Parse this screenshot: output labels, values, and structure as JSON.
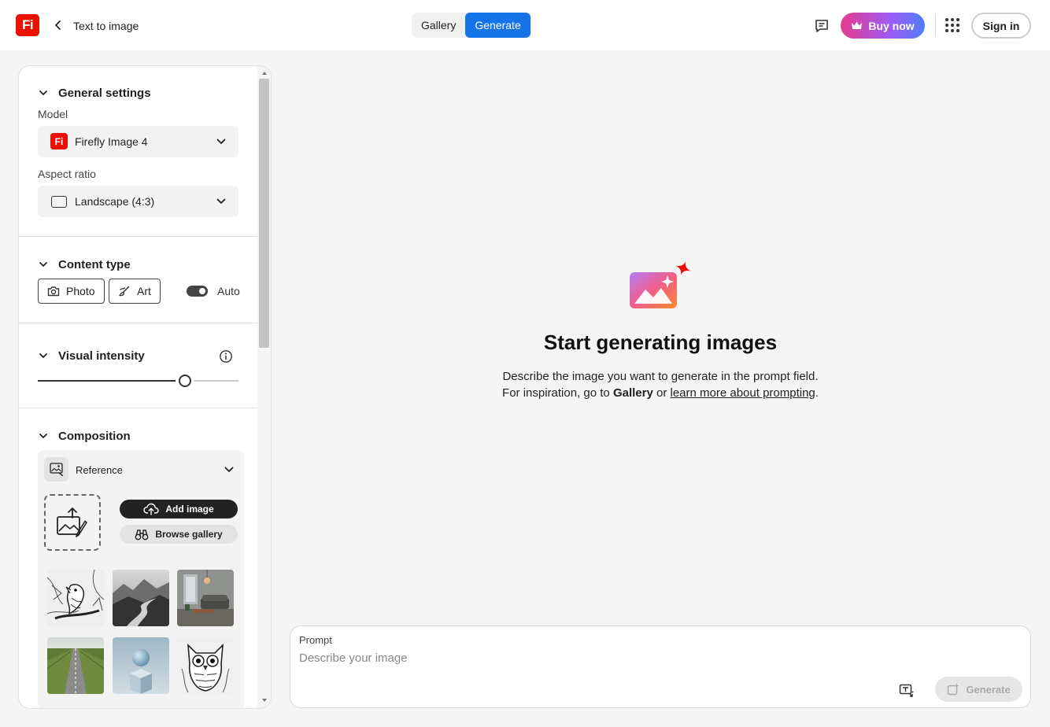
{
  "app": {
    "logo_text": "Fi",
    "breadcrumb": "Text to image"
  },
  "header": {
    "tabs": [
      {
        "label": "Gallery"
      },
      {
        "label": "Generate"
      }
    ],
    "buy_label": "Buy now",
    "signin_label": "Sign in"
  },
  "panel": {
    "general": {
      "title": "General settings",
      "model_label": "Model",
      "model_value": "Firefly Image 4",
      "aspect_label": "Aspect ratio",
      "aspect_value": "Landscape (4:3)"
    },
    "content_type": {
      "title": "Content type",
      "photo": "Photo",
      "art": "Art",
      "auto": "Auto",
      "auto_on": true
    },
    "visual_intensity": {
      "title": "Visual intensity",
      "level_fraction": 0.73
    },
    "composition": {
      "title": "Composition",
      "reference_label": "Reference",
      "add_image": "Add image",
      "browse_gallery": "Browse gallery"
    }
  },
  "empty_state": {
    "title": "Start generating images",
    "line1": "Describe the image you want to generate in the prompt field.",
    "line2_prefix": "For inspiration, go to ",
    "line2_gallery": "Gallery",
    "line2_mid": " or ",
    "line2_link": "learn more about prompting",
    "line2_suffix": "."
  },
  "prompt": {
    "label": "Prompt",
    "placeholder": "Describe your image",
    "value": "",
    "generate_label": "Generate"
  },
  "colors": {
    "accent": "#1473e6",
    "brand": "#eb1000",
    "buy_gradient_start": "#e63c8f",
    "buy_gradient_end": "#4f7ef8"
  }
}
